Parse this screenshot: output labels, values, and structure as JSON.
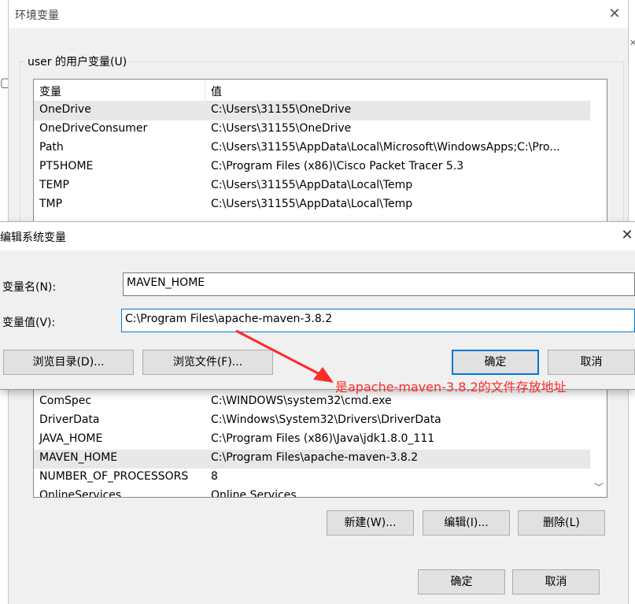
{
  "env_dialog": {
    "title": "环境变量",
    "close_icon": "close-icon",
    "user_group_label": "user 的用户变量(U)",
    "columns": [
      "变量",
      "值"
    ],
    "user_vars": [
      {
        "name": "OneDrive",
        "value": "C:\\Users\\31155\\OneDrive"
      },
      {
        "name": "OneDriveConsumer",
        "value": "C:\\Users\\31155\\OneDrive"
      },
      {
        "name": "Path",
        "value": "C:\\Users\\31155\\AppData\\Local\\Microsoft\\WindowsApps;C:\\Pro..."
      },
      {
        "name": "PT5HOME",
        "value": "C:\\Program Files (x86)\\Cisco Packet Tracer 5.3"
      },
      {
        "name": "TEMP",
        "value": "C:\\Users\\31155\\AppData\\Local\\Temp"
      },
      {
        "name": "TMP",
        "value": "C:\\Users\\31155\\AppData\\Local\\Temp"
      }
    ],
    "system_vars": [
      {
        "name": "ComSpec",
        "value": "C:\\WINDOWS\\system32\\cmd.exe"
      },
      {
        "name": "DriverData",
        "value": "C:\\Windows\\System32\\Drivers\\DriverData"
      },
      {
        "name": "JAVA_HOME",
        "value": "C:\\Program Files (x86)\\Java\\jdk1.8.0_111"
      },
      {
        "name": "MAVEN_HOME",
        "value": "C:\\Program Files\\apache-maven-3.8.2"
      },
      {
        "name": "NUMBER_OF_PROCESSORS",
        "value": "8"
      },
      {
        "name": "OnlineServices",
        "value": "Online Services"
      }
    ],
    "system_buttons": {
      "new": "新建(W)...",
      "edit": "编辑(I)...",
      "delete": "删除(L)"
    },
    "ok": "确定",
    "cancel": "取消"
  },
  "edit_dialog": {
    "title": "编辑系统变量",
    "name_label": "变量名(N):",
    "name_value": "MAVEN_HOME",
    "value_label": "变量值(V):",
    "value_value": "C:\\Program Files\\apache-maven-3.8.2",
    "browse_dir": "浏览目录(D)...",
    "browse_file": "浏览文件(F)...",
    "ok": "确定",
    "cancel": "取消"
  },
  "annotation": {
    "text": "是apache-maven-3.8.2的文件存放地址",
    "color": "#ff2a2a"
  },
  "colors": {
    "accent": "#0078d7",
    "selected_row": "#e8e8e8"
  }
}
